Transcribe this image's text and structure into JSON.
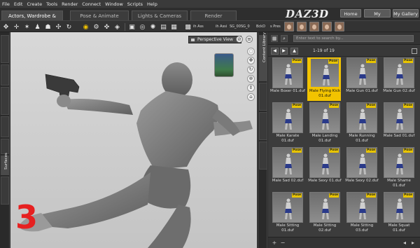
{
  "menu": {
    "items": [
      "File",
      "Edit",
      "Create",
      "Tools",
      "Render",
      "Connect",
      "Window",
      "Scripts",
      "Help"
    ]
  },
  "tabs": [
    {
      "label": "Actors, Wardrobe & Props",
      "active": true
    },
    {
      "label": "Pose & Animate",
      "active": false
    },
    {
      "label": "Lights & Cameras",
      "active": false
    },
    {
      "label": "Render",
      "active": false
    }
  ],
  "brand": {
    "logo": "DAZ",
    "logo_sup": "3D"
  },
  "top_buttons": {
    "home": "Home",
    "account": "My Account",
    "gallery": "My Gallery"
  },
  "toolbar": {
    "presets": [
      "ih Ass",
      "ih Assi",
      "SG_00",
      "SG_0",
      "BckD",
      "s Pres"
    ]
  },
  "left_sidebar_tabs": [
    "",
    "",
    "",
    "",
    "",
    "Surfaces",
    ""
  ],
  "viewport": {
    "view_label": "Perspective View",
    "overlay_number": "3"
  },
  "library": {
    "panel_tab": "Content Library",
    "search_placeholder": "Enter text to search by...",
    "page_count": "1-19 of 19",
    "badge": "Pose",
    "items": [
      {
        "label": "Male Boxer 01.duf",
        "selected": false
      },
      {
        "label": "Male Flying Kick 01.duf",
        "selected": true
      },
      {
        "label": "Male Gun 01.duf",
        "selected": false
      },
      {
        "label": "Male Gun 02.duf",
        "selected": false
      },
      {
        "label": "Male Karate 01.duf",
        "selected": false
      },
      {
        "label": "Male Landing 01.duf",
        "selected": false
      },
      {
        "label": "Male Running 01.duf",
        "selected": false
      },
      {
        "label": "Male Sad 01.duf",
        "selected": false
      },
      {
        "label": "Male Sad 02.duf",
        "selected": false
      },
      {
        "label": "Male Sexy 01.duf",
        "selected": false
      },
      {
        "label": "Male Sexy 02.duf",
        "selected": false
      },
      {
        "label": "Male Shame 01.duf",
        "selected": false
      },
      {
        "label": "Male Sitting 01.duf",
        "selected": false
      },
      {
        "label": "Male Sitting 02.duf",
        "selected": false
      },
      {
        "label": "Male Sitting 03.duf",
        "selected": false
      },
      {
        "label": "Male Squat 01.duf",
        "selected": false
      }
    ]
  },
  "colors": {
    "accent": "#f2c300",
    "overlay_number": "#e62020",
    "viewport_bg": "#c8c8c8",
    "panel_bg": "#3c3c3c"
  }
}
